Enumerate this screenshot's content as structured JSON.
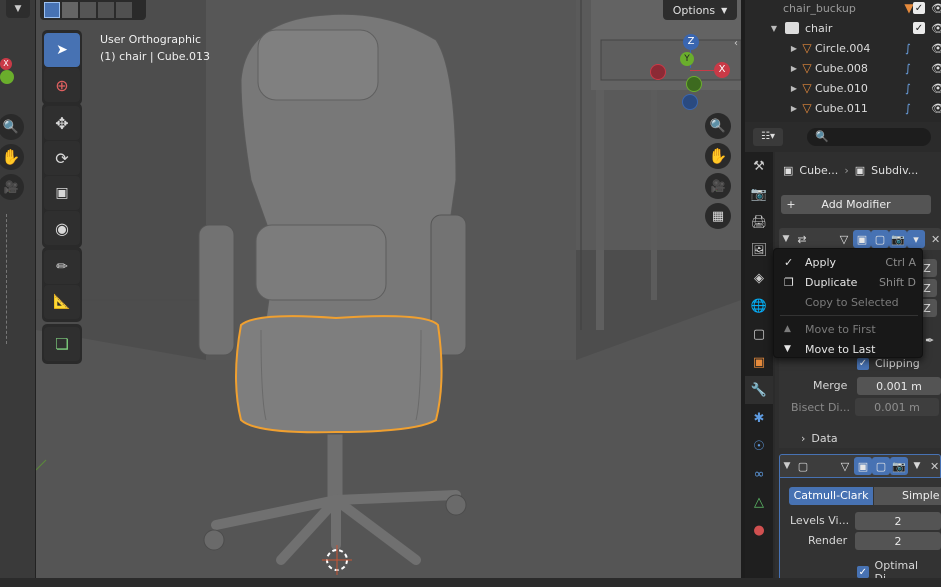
{
  "viewport": {
    "header_line1": "User Orthographic",
    "header_line2": "(1) chair | Cube.013",
    "options_label": "Options"
  },
  "gizmo": {
    "z": "Z",
    "y": "Y",
    "x": "X"
  },
  "outliner": {
    "rows": [
      {
        "name": "chair_buckup"
      },
      {
        "name": "chair"
      },
      {
        "name": "Circle.004"
      },
      {
        "name": "Cube.008"
      },
      {
        "name": "Cube.010"
      },
      {
        "name": "Cube.011"
      }
    ]
  },
  "properties": {
    "breadcrumb_object": "Cube...",
    "breadcrumb_modifier": "Subdiv...",
    "add_modifier_label": "Add Modifier",
    "axis_letter": "Z",
    "clipping_label": "Clipping",
    "merge_label": "Merge",
    "merge_value": "0.001 m",
    "bisect_label": "Bisect Di...",
    "bisect_value": "0.001 m",
    "data_label": "Data",
    "catmull_label": "Catmull-Clark",
    "simple_label": "Simple",
    "levels_label": "Levels Vi...",
    "levels_value": "2",
    "render_label": "Render",
    "render_value": "2",
    "optimal_label": "Optimal Di..."
  },
  "context_menu": {
    "items": [
      {
        "label": "Apply",
        "shortcut": "Ctrl A",
        "enabled": true
      },
      {
        "label": "Duplicate",
        "shortcut": "Shift D",
        "enabled": true
      },
      {
        "label": "Copy to Selected",
        "shortcut": "",
        "enabled": false
      },
      {
        "label": "Move to First",
        "shortcut": "",
        "enabled": false
      },
      {
        "label": "Move to Last",
        "shortcut": "",
        "enabled": true
      }
    ]
  },
  "left_strip": {
    "axis_x": "X"
  },
  "colors": {
    "accent_blue": "#4772b3",
    "selection_orange": "#f0a030",
    "viewport_bg": "#505050"
  }
}
